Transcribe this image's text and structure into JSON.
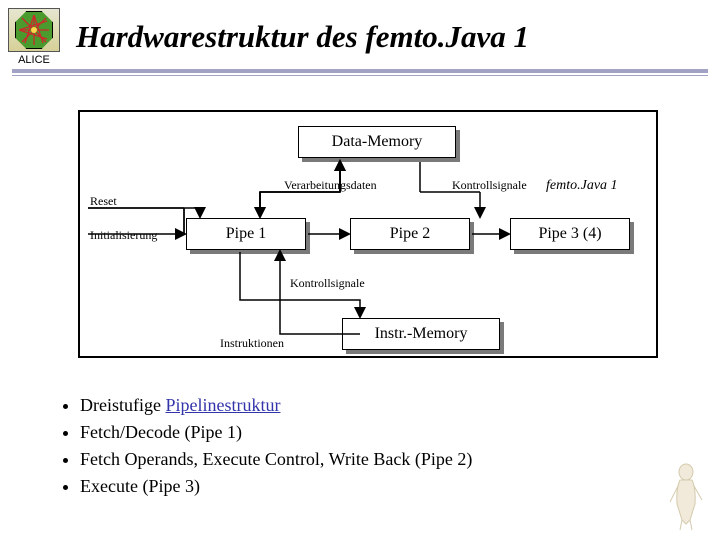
{
  "header": {
    "logo_label": "ALICE",
    "title": "Hardwarestruktur des femto.Java 1"
  },
  "diagram": {
    "data_memory": "Data-Memory",
    "label_verarbeitung": "Verarbeitungsdaten",
    "label_kontroll_top": "Kontrollsignale",
    "label_femto": "femto.Java 1",
    "reset": "Reset",
    "init": "Initialisierung",
    "pipe1": "Pipe 1",
    "pipe2": "Pipe 2",
    "pipe3": "Pipe 3 (4)",
    "label_kontroll_bottom": "Kontrollsignale",
    "label_instruktionen": "Instruktionen",
    "instr_memory": "Instr.-Memory"
  },
  "bullets": {
    "items": [
      {
        "prefix": "Dreistufige ",
        "link": "Pipelinestruktur",
        "suffix": ""
      },
      {
        "prefix": "Fetch/Decode (Pipe 1)",
        "link": "",
        "suffix": ""
      },
      {
        "prefix": "Fetch Operands, Execute Control, Write Back (Pipe 2)",
        "link": "",
        "suffix": ""
      },
      {
        "prefix": "Execute (Pipe 3)",
        "link": "",
        "suffix": ""
      }
    ]
  }
}
